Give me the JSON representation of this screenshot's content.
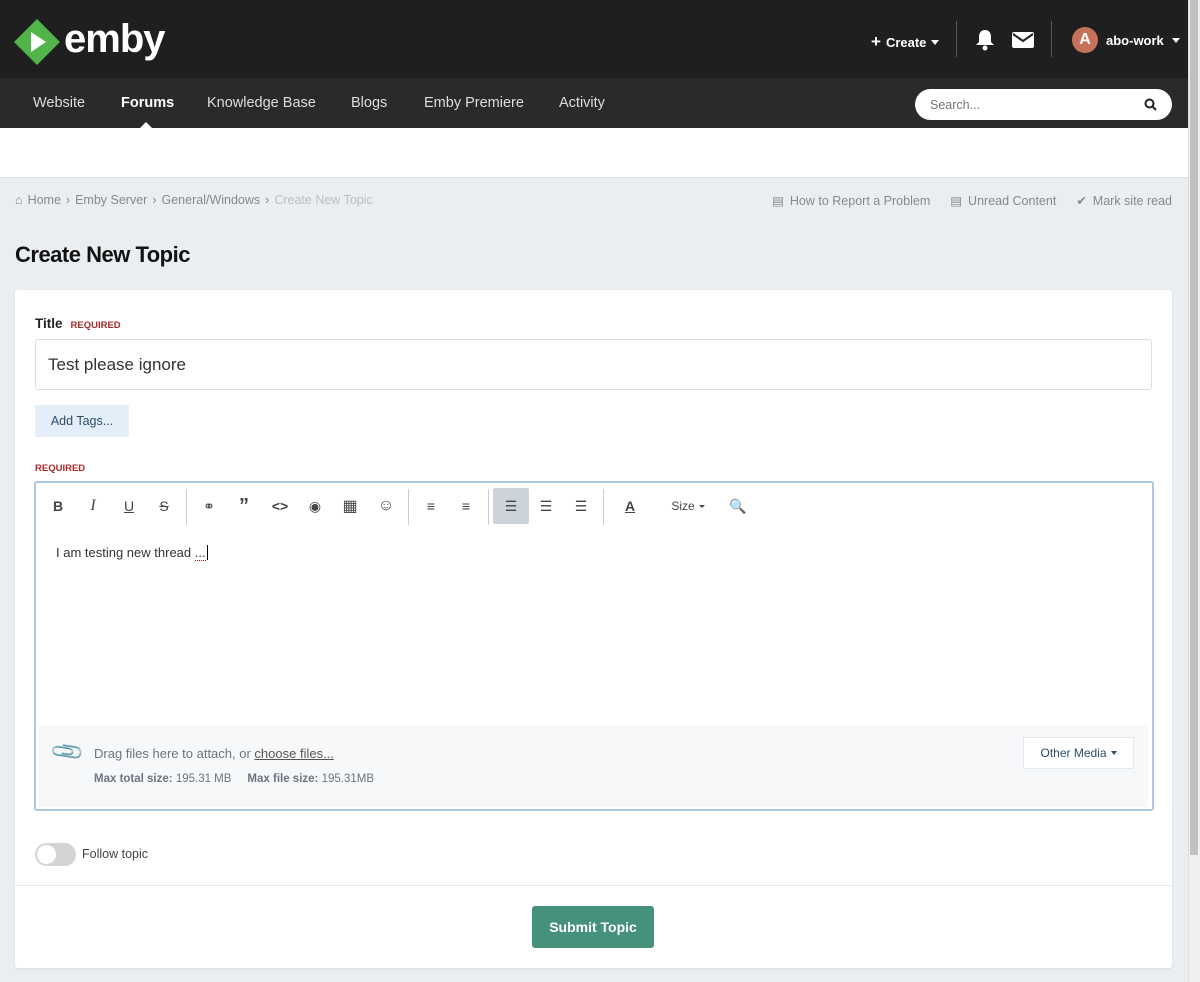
{
  "header": {
    "logo_text": "emby",
    "create_label": "Create",
    "username": "abo-work",
    "avatar_letter": "A"
  },
  "nav": {
    "items": [
      "Website",
      "Forums",
      "Knowledge Base",
      "Blogs",
      "Emby Premiere",
      "Activity"
    ],
    "search_placeholder": "Search..."
  },
  "breadcrumb": [
    "Home",
    "Emby Server",
    "General/Windows",
    "Create New Topic"
  ],
  "quick_links": [
    "How to Report a Problem",
    "Unread Content",
    "Mark site read"
  ],
  "page_title": "Create New Topic",
  "form": {
    "title_label": "Title",
    "required": "REQUIRED",
    "title_value": "Test please ignore",
    "add_tags": "Add Tags...",
    "editor": {
      "size_label": "Size",
      "content": "I am testing new thread",
      "content_suffix": "..."
    },
    "attach": {
      "drag_text": "Drag files here to attach, or ",
      "choose_files": "choose files...",
      "max_total_label": "Max total size:",
      "max_total": "195.31 MB",
      "max_file_label": "Max file size:",
      "max_file": "195.31MB",
      "other_media": "Other Media"
    },
    "follow_label": "Follow topic",
    "follow_on": false,
    "submit": "Submit Topic"
  },
  "colors": {
    "brand_green": "#52b54b",
    "submit": "#46917c",
    "required": "#a52a2a"
  }
}
